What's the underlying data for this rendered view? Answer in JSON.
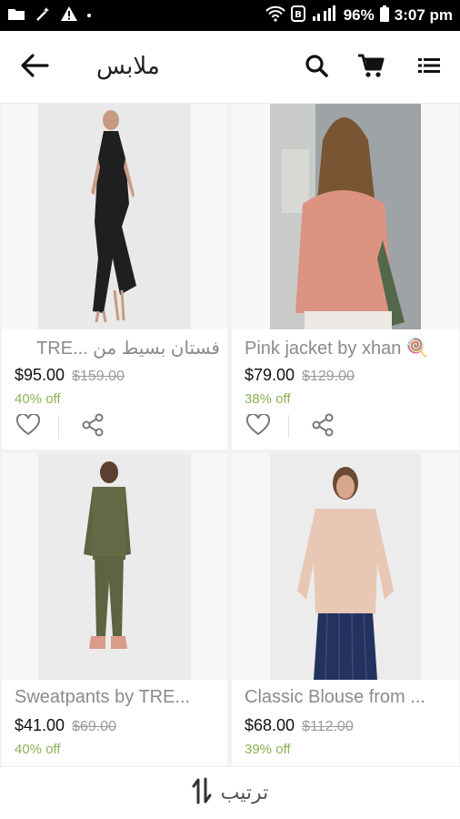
{
  "status_bar": {
    "battery": "96%",
    "time": "3:07 pm"
  },
  "app_bar": {
    "title": "ملابس",
    "icons": [
      "arrow-back-icon",
      "search-icon",
      "cart-icon",
      "menu-icon"
    ]
  },
  "products": [
    {
      "title": "فستان بسيط من ...TRE",
      "price": "$95.00",
      "old_price": "$159.00",
      "discount": "40% off"
    },
    {
      "title": "Pink jacket by xhan 🍭",
      "price": "$79.00",
      "old_price": "$129.00",
      "discount": "38% off"
    },
    {
      "title": "Sweatpants by TRE...",
      "price": "$41.00",
      "old_price": "$69.00",
      "discount": "40% off"
    },
    {
      "title": "Classic Blouse from ...",
      "price": "$68.00",
      "old_price": "$112.00",
      "discount": "39% off"
    }
  ],
  "sort": {
    "label": "ترتيب"
  },
  "colors": {
    "discount_green": "#8cb256",
    "accent_dark": "#111111"
  }
}
